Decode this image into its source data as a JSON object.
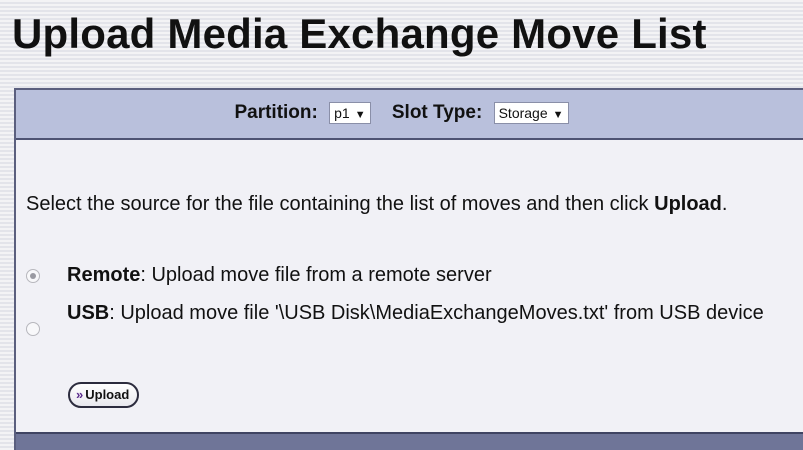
{
  "page": {
    "title": "Upload Media Exchange Move List"
  },
  "filters": {
    "partition_label": "Partition:",
    "partition_value": "p1",
    "slot_type_label": "Slot Type:",
    "slot_type_value": "Storage",
    "dropdown_icon": "triangle-down-icon"
  },
  "instructions": {
    "text_before": "Select the source for the file containing the list of moves and then click ",
    "text_bold": "Upload",
    "text_after": "."
  },
  "sources": [
    {
      "name": "Remote",
      "description": ": Upload move file from a remote server",
      "selected": true
    },
    {
      "name": "USB",
      "description": ": Upload move file '\\USB Disk\\MediaExchangeMoves.txt' from USB device",
      "selected": false
    }
  ],
  "upload_button": {
    "icon": "double-chevron-right-icon",
    "glyph": "»",
    "label": "Upload"
  },
  "colors": {
    "filter_bar": "#b9c0dc",
    "footer_bar": "#6f7598",
    "panel_border": "#5b5f7e",
    "button_chevron": "#5a2b8c"
  }
}
